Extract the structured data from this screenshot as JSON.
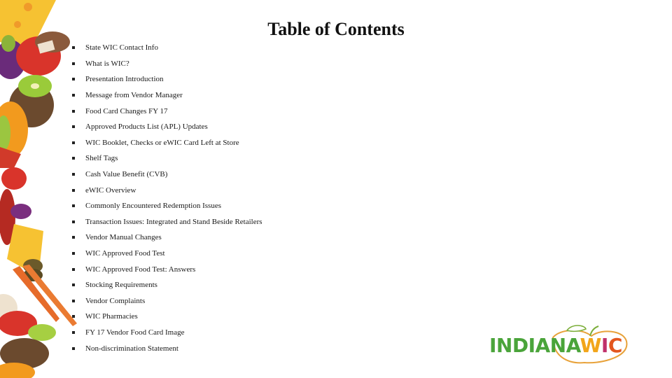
{
  "slide": {
    "title": "Table of Contents",
    "items": [
      "State WIC Contact Info",
      "What is WIC?",
      "Presentation Introduction",
      "Message from Vendor Manager",
      "Food Card Changes FY 17",
      "Approved Products List (APL) Updates",
      "WIC Booklet, Checks or eWIC Card Left at Store",
      "Shelf Tags",
      "Cash Value Benefit (CVB)",
      "eWIC Overview",
      "Commonly Encountered Redemption Issues",
      "Transaction Issues: Integrated and Stand Beside Retailers",
      "Vendor Manual Changes",
      "WIC Approved Food Test",
      "WIC Approved Food Test: Answers",
      "Stocking Requirements",
      "Vendor Complaints",
      "WIC Pharmacies",
      "FY 17 Vendor Food Card Image",
      "Non-discrimination Statement"
    ]
  },
  "logo": {
    "part1": "INDIANA",
    "w": "W",
    "i": "I",
    "c": "C",
    "colors": {
      "green": "#4aa43a",
      "yellow": "#f2a51a",
      "magenta": "#c0306a",
      "orange": "#e3561e"
    }
  },
  "decoration": {
    "left_border": "illustrated fruits and vegetables (cheese, apple, mushroom, kiwi, eggplant, carrots, strawberry)"
  }
}
